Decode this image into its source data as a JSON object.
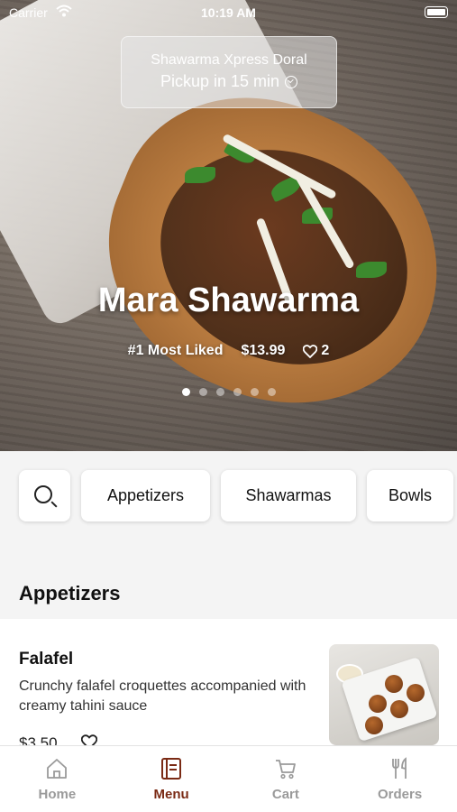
{
  "status_bar": {
    "carrier": "Carrier",
    "time": "10:19 AM"
  },
  "store": {
    "name": "Shawarma Xpress Doral",
    "pickup": "Pickup in 15 min"
  },
  "featured": {
    "title": "Mara Shawarma",
    "badge": "#1 Most Liked",
    "price": "$13.99",
    "likes": "2",
    "slide_count": 6,
    "active_slide": 1
  },
  "categories": {
    "search_icon": "search-icon",
    "items": [
      "Appetizers",
      "Shawarmas",
      "Bowls"
    ]
  },
  "section": {
    "title": "Appetizers"
  },
  "menu_items": [
    {
      "name": "Falafel",
      "description": "Crunchy falafel croquettes accompanied with creamy tahini sauce",
      "price": "$3.50"
    }
  ],
  "tabs": [
    {
      "label": "Home",
      "icon": "home-icon",
      "active": false
    },
    {
      "label": "Menu",
      "icon": "menu-icon",
      "active": true
    },
    {
      "label": "Cart",
      "icon": "cart-icon",
      "active": false
    },
    {
      "label": "Orders",
      "icon": "orders-icon",
      "active": false
    }
  ],
  "colors": {
    "accent": "#7a2a14",
    "tab_inactive": "#9a9a9a"
  }
}
